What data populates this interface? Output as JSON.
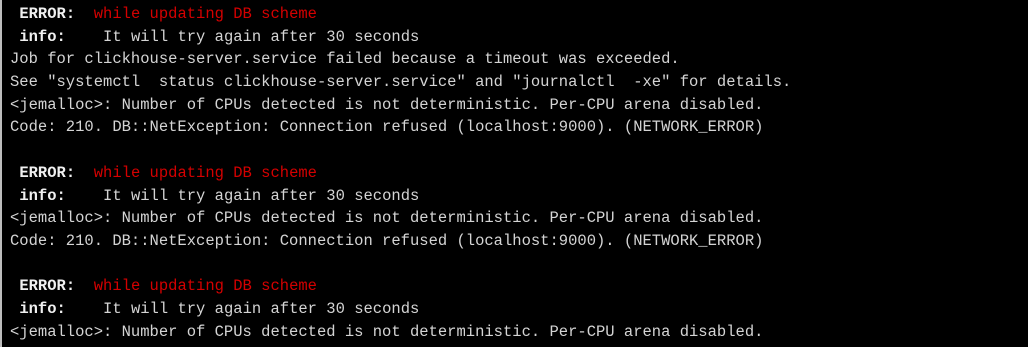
{
  "colors": {
    "background": "#000000",
    "text": "#d4d4d4",
    "error_message": "#d40000"
  },
  "terminal": {
    "blocks": [
      {
        "error_label": "ERROR:",
        "error_message": "while updating DB scheme",
        "info_label": "info:",
        "info_message": "It will try again after 30 seconds",
        "lines": [
          "Job for clickhouse-server.service failed because a timeout was exceeded.",
          "See \"systemctl  status clickhouse-server.service\" and \"journalctl  -xe\" for details.",
          "<jemalloc>: Number of CPUs detected is not deterministic. Per-CPU arena disabled.",
          "Code: 210. DB::NetException: Connection refused (localhost:9000). (NETWORK_ERROR)"
        ]
      },
      {
        "error_label": "ERROR:",
        "error_message": "while updating DB scheme",
        "info_label": "info:",
        "info_message": "It will try again after 30 seconds",
        "lines": [
          "<jemalloc>: Number of CPUs detected is not deterministic. Per-CPU arena disabled.",
          "Code: 210. DB::NetException: Connection refused (localhost:9000). (NETWORK_ERROR)"
        ]
      },
      {
        "error_label": "ERROR:",
        "error_message": "while updating DB scheme",
        "info_label": "info:",
        "info_message": "It will try again after 30 seconds",
        "lines": [
          "<jemalloc>: Number of CPUs detected is not deterministic. Per-CPU arena disabled."
        ]
      }
    ]
  }
}
